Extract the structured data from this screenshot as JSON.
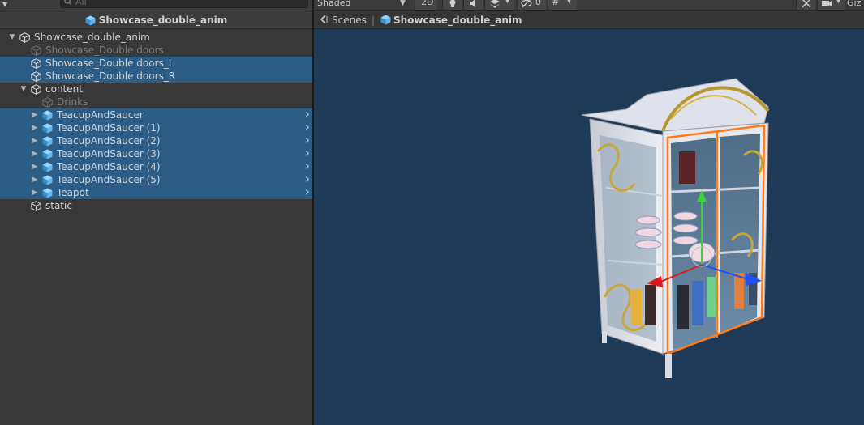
{
  "hierarchy": {
    "search_placeholder": "All",
    "scene_title": "Showcase_double_anim",
    "rows": [
      {
        "label": "Showcase_double_anim",
        "indent": 0,
        "fold": "open",
        "selected": false,
        "dim": false,
        "prefab": false,
        "go": false
      },
      {
        "label": "Showcase_Double doors",
        "indent": 1,
        "fold": "none",
        "selected": false,
        "dim": true,
        "prefab": false,
        "go": false
      },
      {
        "label": "Showcase_Double doors_L",
        "indent": 1,
        "fold": "none",
        "selected": true,
        "dim": false,
        "prefab": false,
        "go": false
      },
      {
        "label": "Showcase_Double doors_R",
        "indent": 1,
        "fold": "none",
        "selected": true,
        "dim": false,
        "prefab": false,
        "go": false
      },
      {
        "label": "content",
        "indent": 1,
        "fold": "open",
        "selected": false,
        "dim": false,
        "prefab": false,
        "go": false
      },
      {
        "label": "Drinks",
        "indent": 2,
        "fold": "none",
        "selected": false,
        "dim": true,
        "prefab": false,
        "go": false
      },
      {
        "label": "TeacupAndSaucer",
        "indent": 2,
        "fold": "closed",
        "selected": true,
        "dim": false,
        "prefab": true,
        "go": true
      },
      {
        "label": "TeacupAndSaucer (1)",
        "indent": 2,
        "fold": "closed",
        "selected": true,
        "dim": false,
        "prefab": true,
        "go": true
      },
      {
        "label": "TeacupAndSaucer (2)",
        "indent": 2,
        "fold": "closed",
        "selected": true,
        "dim": false,
        "prefab": true,
        "go": true
      },
      {
        "label": "TeacupAndSaucer (3)",
        "indent": 2,
        "fold": "closed",
        "selected": true,
        "dim": false,
        "prefab": true,
        "go": true
      },
      {
        "label": "TeacupAndSaucer (4)",
        "indent": 2,
        "fold": "closed",
        "selected": true,
        "dim": false,
        "prefab": true,
        "go": true
      },
      {
        "label": "TeacupAndSaucer (5)",
        "indent": 2,
        "fold": "closed",
        "selected": true,
        "dim": false,
        "prefab": true,
        "go": true
      },
      {
        "label": "Teapot",
        "indent": 2,
        "fold": "closed",
        "selected": true,
        "dim": false,
        "prefab": true,
        "go": true
      },
      {
        "label": "static",
        "indent": 1,
        "fold": "none",
        "selected": false,
        "dim": false,
        "prefab": false,
        "go": false
      }
    ]
  },
  "scene_toolbar": {
    "shading_mode": "Shaded",
    "mode_2d": "2D",
    "hidden_count": "0",
    "gizmos_label": "Giz"
  },
  "breadcrumbs": {
    "root": "Scenes",
    "current": "Showcase_double_anim"
  },
  "colors": {
    "selection": "#2c5d87",
    "viewport_bg": "#1f3a57",
    "panel_bg": "#383838",
    "outline": "#ff7a1a",
    "gizmo_x": "#e01818",
    "gizmo_y": "#3ad43a",
    "gizmo_z": "#2050ff"
  }
}
